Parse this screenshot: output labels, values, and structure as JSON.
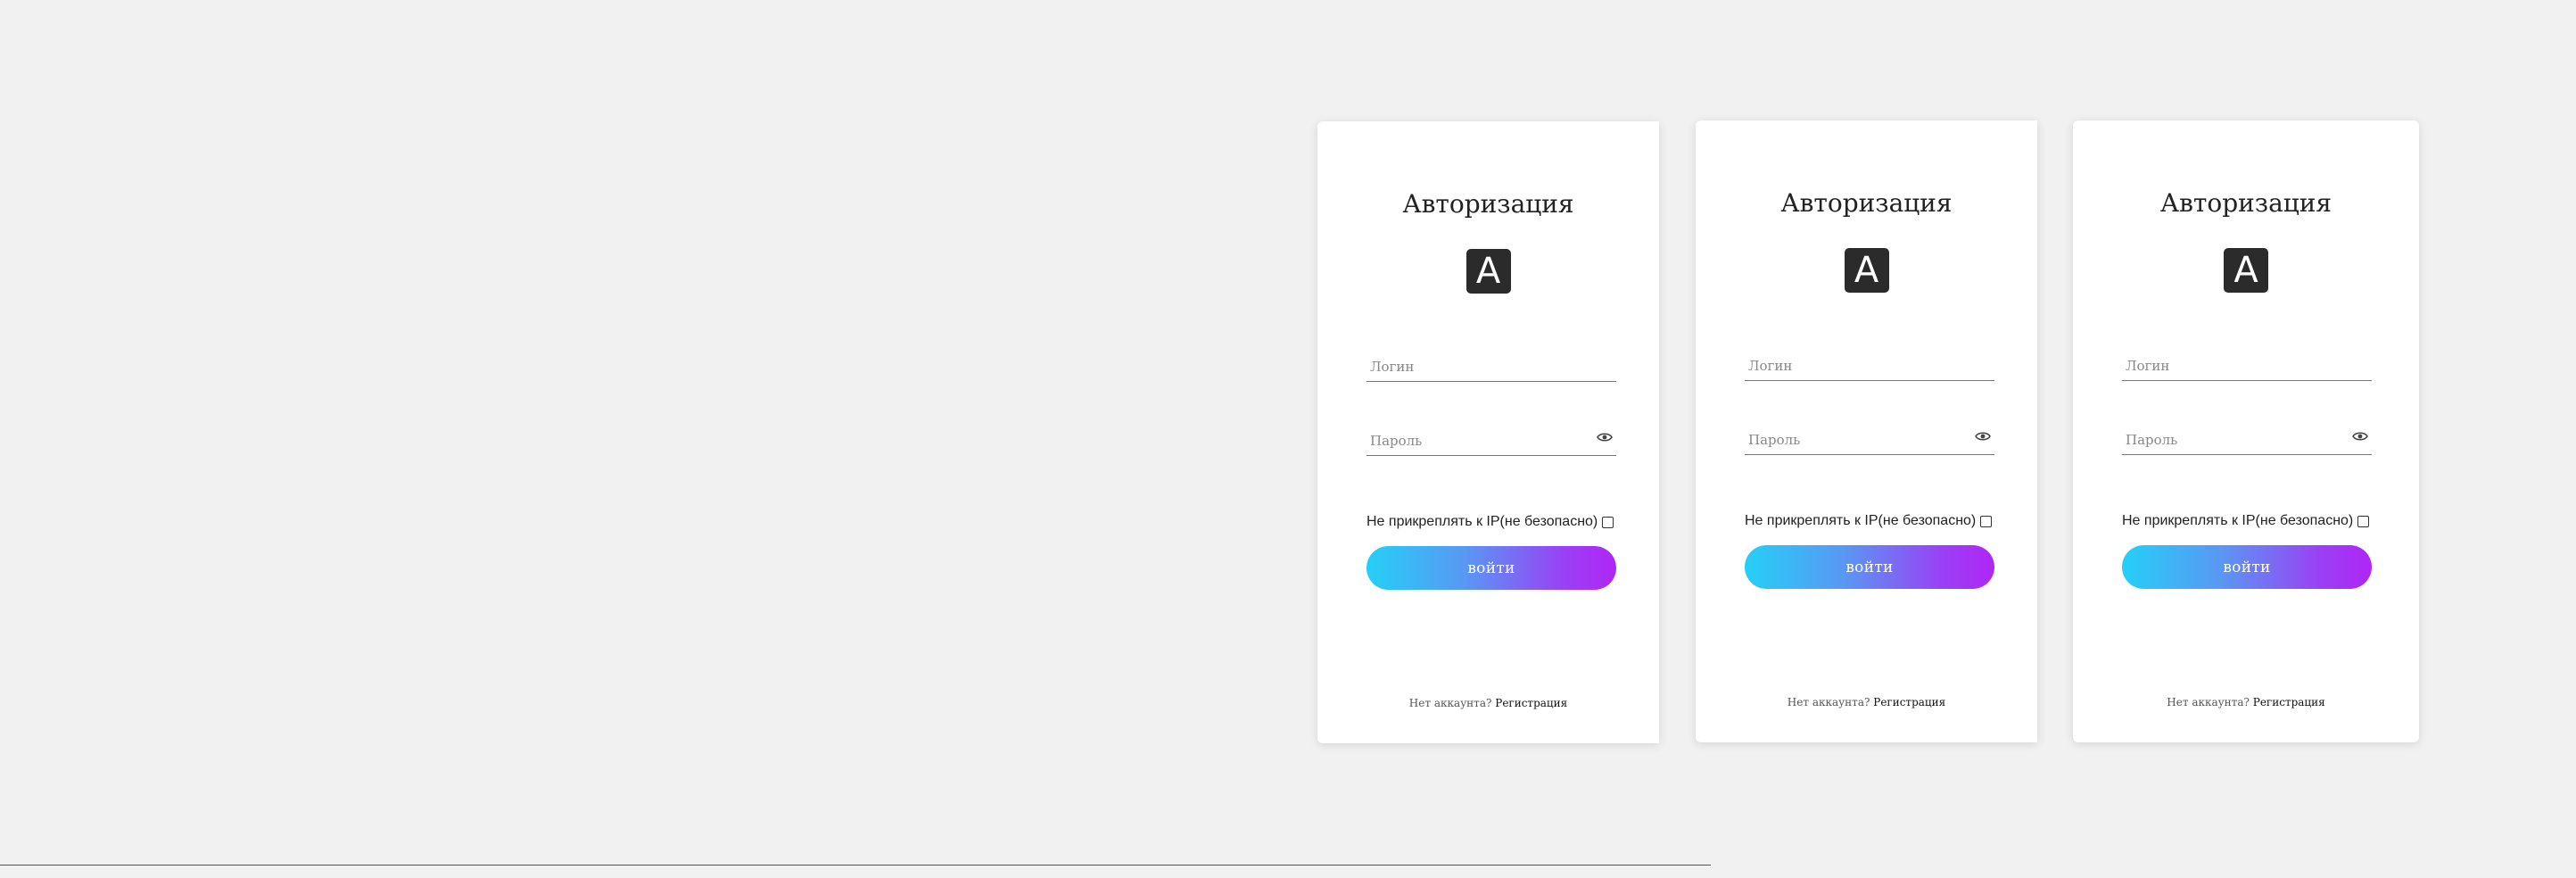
{
  "cards": [
    {
      "title": "Авторизация",
      "logo_letter": "A",
      "login_placeholder": "Логин",
      "password_placeholder": "Пароль",
      "ip_label": "Не прикреплять к IP(не безопасно)",
      "submit_label": "войти",
      "footer_text": "Нет аккаунта?",
      "register_link": "Регистрация"
    },
    {
      "title": "Авторизация",
      "logo_letter": "A",
      "login_placeholder": "Логин",
      "password_placeholder": "Пароль",
      "ip_label": "Не прикреплять к IP(не безопасно)",
      "submit_label": "войти",
      "footer_text": "Нет аккаунта?",
      "register_link": "Регистрация"
    },
    {
      "title": "Авторизация",
      "logo_letter": "A",
      "login_placeholder": "Логин",
      "password_placeholder": "Пароль",
      "ip_label": "Не прикреплять к IP(не безопасно)",
      "submit_label": "войти",
      "footer_text": "Нет аккаунта?",
      "register_link": "Регистрация"
    }
  ],
  "icons": {
    "logo": "letter-a-logo-icon",
    "password_toggle": "eye-icon",
    "checkbox": "checkbox-icon"
  },
  "colors": {
    "background": "#f1f1f1",
    "card": "#ffffff",
    "button_gradient_start": "#24d0f7",
    "button_gradient_end": "#b026f6",
    "logo_bg": "#2b2b2b"
  }
}
